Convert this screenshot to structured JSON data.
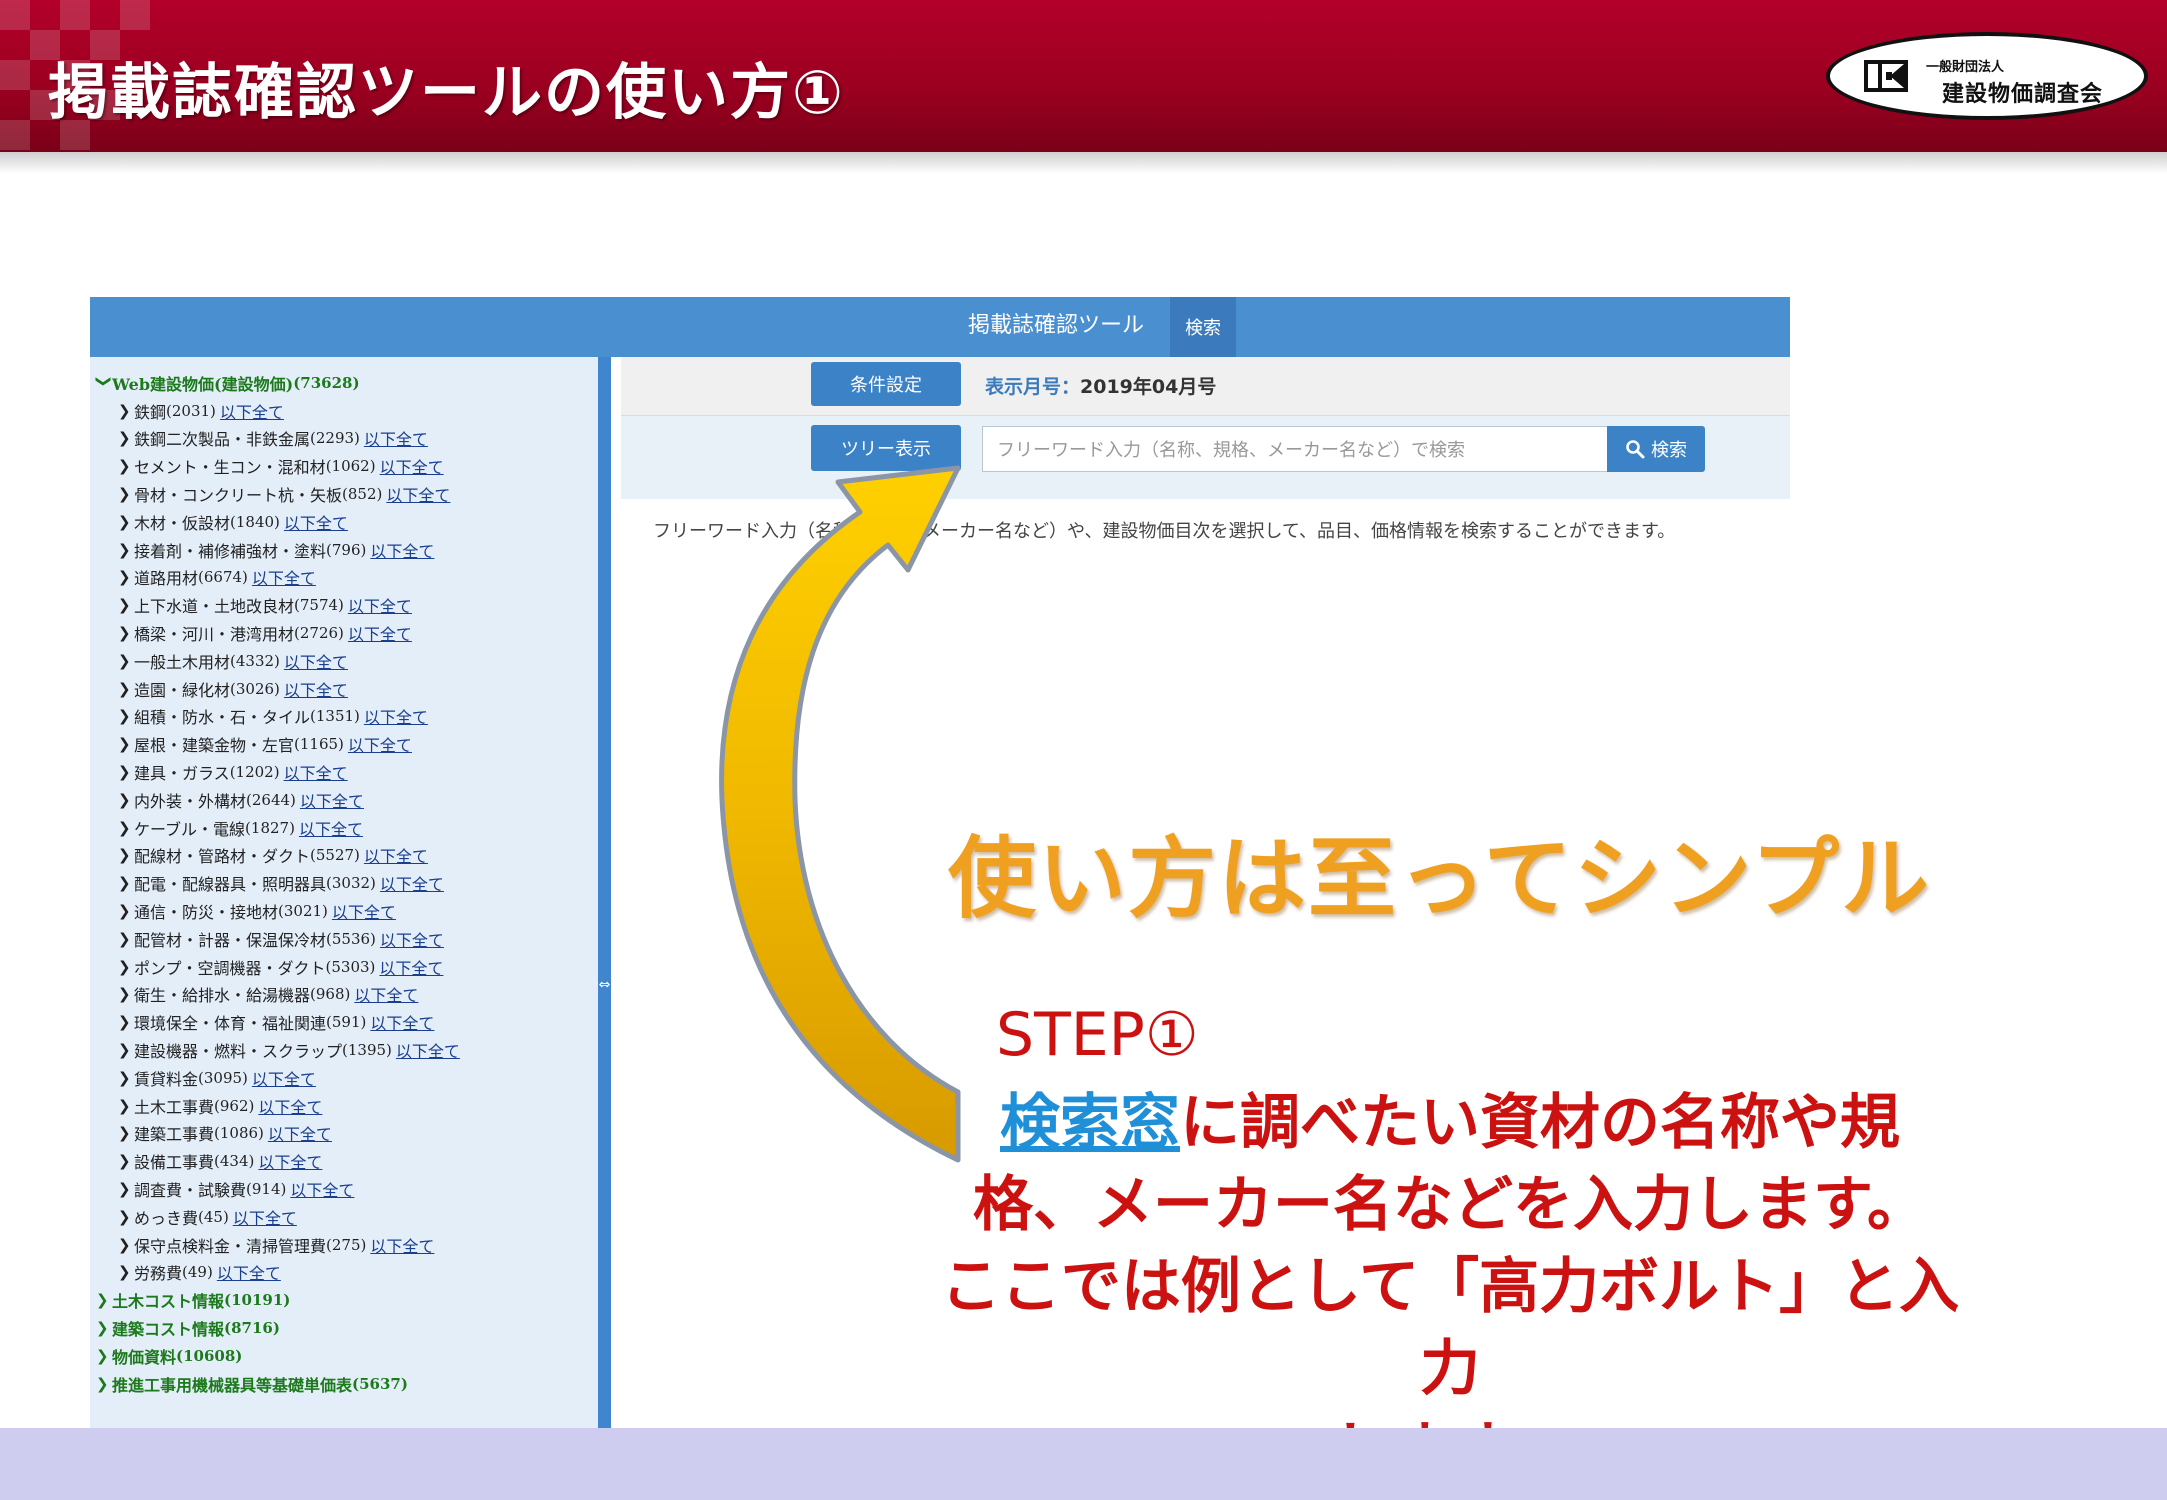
{
  "slide": {
    "title": "掲載誌確認ツールの使い方①",
    "logo": {
      "org_type": "一般財団法人",
      "org_name": "建設物価調査会"
    }
  },
  "app": {
    "title": "掲載誌確認ツール",
    "search_tab": "検索",
    "condition_button": "条件設定",
    "month_label": "表示月号：",
    "month_value": "2019年04月号",
    "tree_button": "ツリー表示",
    "search": {
      "placeholder": "フリーワード入力（名称、規格、メーカー名など）で検索",
      "button_label": "検索"
    },
    "description": "フリーワード入力（名称、規格、メーカー名など）や、建設物価目次を選択して、品目、価格情報を検索することができます。",
    "splitter_symbol": "⇔",
    "link_text": "以下全て",
    "tree": {
      "root": {
        "label": "Web建設物価(建設物価)",
        "count": "(73628)"
      },
      "children": [
        {
          "label": "鉄鋼",
          "count": "(2031)"
        },
        {
          "label": "鉄鋼二次製品・非鉄金属",
          "count": "(2293)"
        },
        {
          "label": "セメント・生コン・混和材",
          "count": "(1062)"
        },
        {
          "label": "骨材・コンクリート杭・矢板",
          "count": "(852)"
        },
        {
          "label": "木材・仮設材",
          "count": "(1840)"
        },
        {
          "label": "接着剤・補修補強材・塗料",
          "count": "(796)"
        },
        {
          "label": "道路用材",
          "count": "(6674)"
        },
        {
          "label": "上下水道・土地改良材",
          "count": "(7574)"
        },
        {
          "label": "橋梁・河川・港湾用材",
          "count": "(2726)"
        },
        {
          "label": "一般土木用材",
          "count": "(4332)"
        },
        {
          "label": "造園・緑化材",
          "count": "(3026)"
        },
        {
          "label": "組積・防水・石・タイル",
          "count": "(1351)"
        },
        {
          "label": "屋根・建築金物・左官",
          "count": "(1165)"
        },
        {
          "label": "建具・ガラス",
          "count": "(1202)"
        },
        {
          "label": "内外装・外構材",
          "count": "(2644)"
        },
        {
          "label": "ケーブル・電線",
          "count": "(1827)"
        },
        {
          "label": "配線材・管路材・ダクト",
          "count": "(5527)"
        },
        {
          "label": "配電・配線器具・照明器具",
          "count": "(3032)"
        },
        {
          "label": "通信・防災・接地材",
          "count": "(3021)"
        },
        {
          "label": "配管材・計器・保温保冷材",
          "count": "(5536)"
        },
        {
          "label": "ポンプ・空調機器・ダクト",
          "count": "(5303)"
        },
        {
          "label": "衛生・給排水・給湯機器",
          "count": "(968)"
        },
        {
          "label": "環境保全・体育・福祉関連",
          "count": "(591)"
        },
        {
          "label": "建設機器・燃料・スクラップ",
          "count": "(1395)"
        },
        {
          "label": "賃貸料金",
          "count": "(3095)"
        },
        {
          "label": "土木工事費",
          "count": "(962)"
        },
        {
          "label": "建築工事費",
          "count": "(1086)"
        },
        {
          "label": "設備工事費",
          "count": "(434)"
        },
        {
          "label": "調査費・試験費",
          "count": "(914)"
        },
        {
          "label": "めっき費",
          "count": "(45)"
        },
        {
          "label": "保守点検料金・清掃管理費",
          "count": "(275)"
        },
        {
          "label": "労務費",
          "count": "(49)"
        }
      ],
      "other_roots": [
        {
          "label": "土木コスト情報",
          "count": "(10191)"
        },
        {
          "label": "建築コスト情報",
          "count": "(8716)"
        },
        {
          "label": "物価資料",
          "count": "(10608)"
        },
        {
          "label": "推進工事用機械器具等基礎単価表",
          "count": "(5637)"
        }
      ]
    }
  },
  "callout": {
    "headline": "使い方は至ってシンプル",
    "step": "STEP①",
    "keyword": "検索窓",
    "line1_rest": "に調べたい資材の名称や規",
    "line2": "格、メーカー名などを入力します。",
    "line3": "ここでは例として「高力ボルト」と入力",
    "line4": "します。"
  },
  "colors": {
    "header_red": "#9a0020",
    "app_blue": "#4a8fd0",
    "tree_green": "#1c7a1c",
    "headline_orange": "#f0a020",
    "callout_red": "#cc1111",
    "keyword_blue": "#1f8fd8",
    "arrow_yellow": "#f5c000",
    "bottom_band": "#ceccef"
  },
  "icons": {
    "search": "search-icon",
    "tree_expanded": "chevron-down-icon",
    "tree_collapsed": "chevron-right-icon",
    "splitter": "resize-horizontal-icon"
  }
}
